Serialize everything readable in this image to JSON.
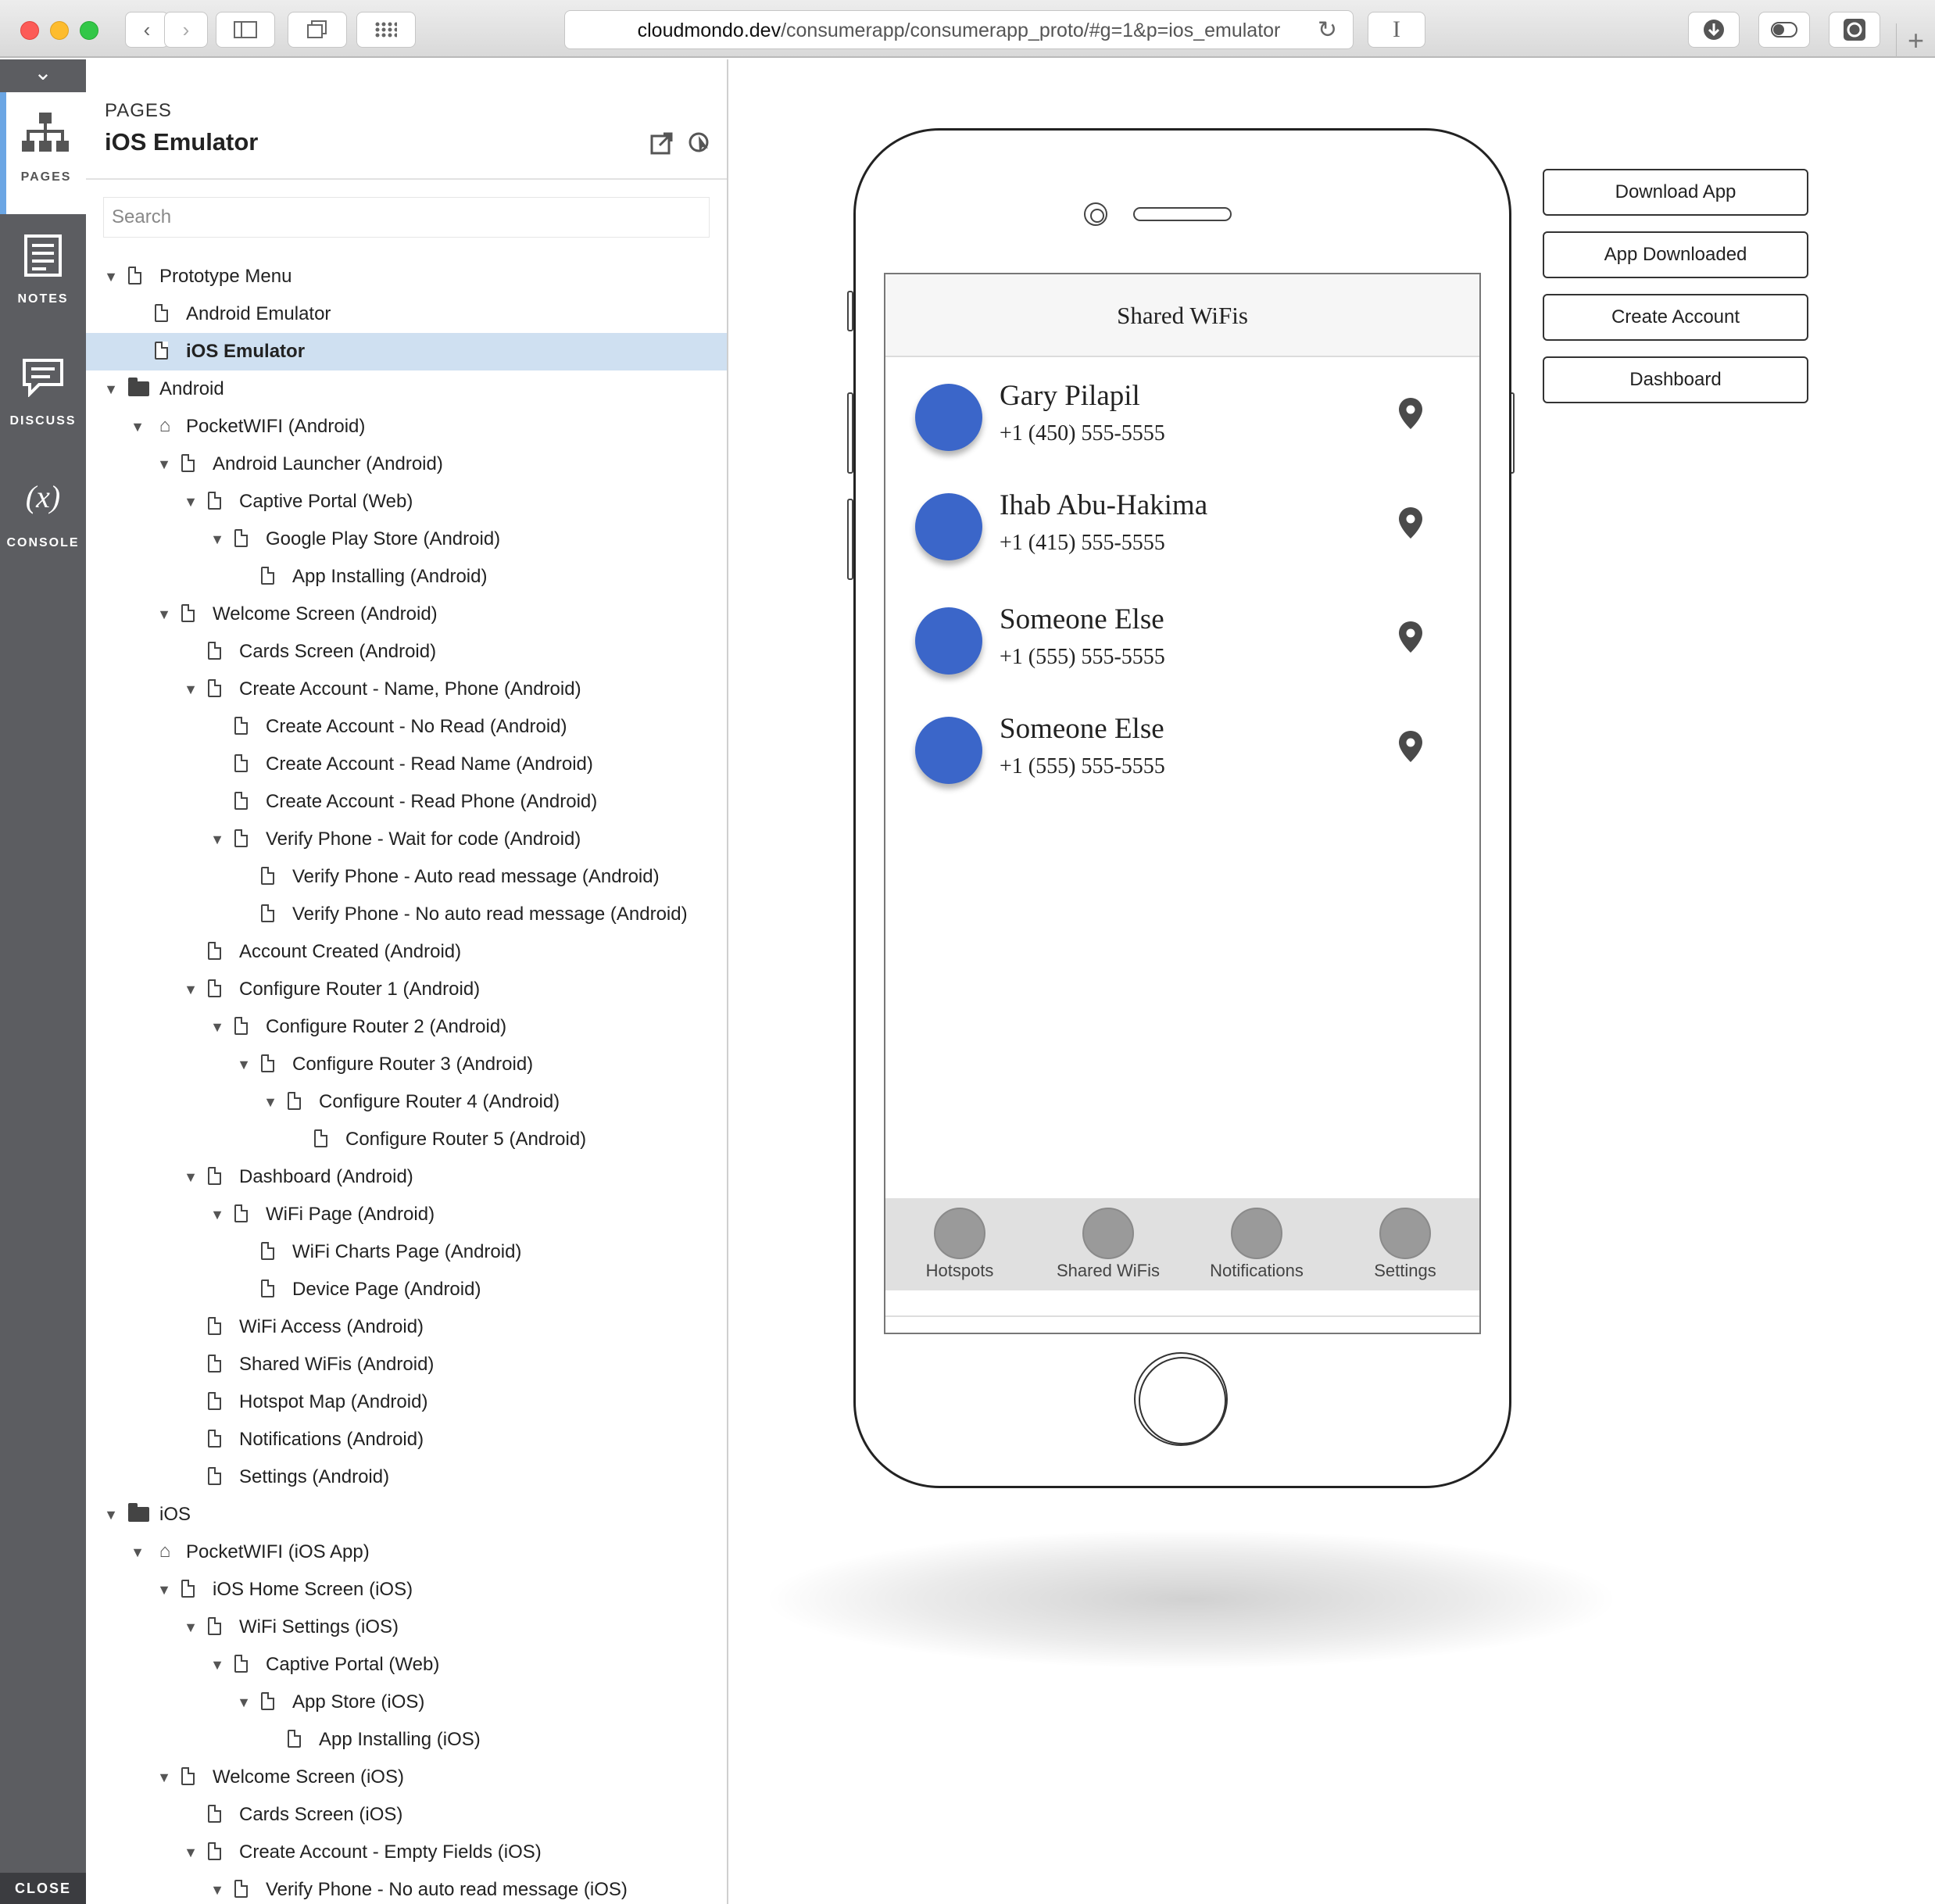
{
  "browser": {
    "url_host": "cloudmondo.dev",
    "url_path": "/consumerapp/consumerapp_proto/#g=1&p=ios_emulator",
    "text_cursor_glyph": "I"
  },
  "rail": {
    "items": [
      {
        "label": "PAGES",
        "icon": "sitemap-icon",
        "active": true
      },
      {
        "label": "NOTES",
        "icon": "notes-icon"
      },
      {
        "label": "DISCUSS",
        "icon": "discuss-icon"
      },
      {
        "label": "CONSOLE",
        "icon": "variable-icon",
        "glyph": "(x)"
      }
    ],
    "close_label": "CLOSE"
  },
  "panel": {
    "subtitle": "PAGES",
    "title": "iOS Emulator",
    "search_placeholder": "Search"
  },
  "tree": [
    {
      "label": "Prototype Menu",
      "level": 0,
      "icon": "page",
      "expanded": true
    },
    {
      "label": "Android Emulator",
      "level": 1,
      "icon": "page"
    },
    {
      "label": "iOS Emulator",
      "level": 1,
      "icon": "page",
      "selected": true
    },
    {
      "label": "Android",
      "level": 0,
      "icon": "folder",
      "expanded": true
    },
    {
      "label": "PocketWIFI (Android)",
      "level": 1,
      "icon": "flow",
      "expanded": true
    },
    {
      "label": "Android Launcher (Android)",
      "level": 2,
      "icon": "page",
      "expanded": true
    },
    {
      "label": "Captive Portal (Web)",
      "level": 3,
      "icon": "page",
      "expanded": true
    },
    {
      "label": "Google Play Store (Android)",
      "level": 4,
      "icon": "page",
      "expanded": true
    },
    {
      "label": "App Installing (Android)",
      "level": 5,
      "icon": "page"
    },
    {
      "label": "Welcome Screen (Android)",
      "level": 2,
      "icon": "page",
      "expanded": true
    },
    {
      "label": "Cards Screen (Android)",
      "level": 3,
      "icon": "page"
    },
    {
      "label": "Create Account - Name, Phone (Android)",
      "level": 3,
      "icon": "page",
      "expanded": true
    },
    {
      "label": "Create Account - No Read (Android)",
      "level": 4,
      "icon": "page"
    },
    {
      "label": "Create Account - Read Name (Android)",
      "level": 4,
      "icon": "page"
    },
    {
      "label": "Create Account - Read Phone (Android)",
      "level": 4,
      "icon": "page"
    },
    {
      "label": "Verify Phone - Wait for code (Android)",
      "level": 4,
      "icon": "page",
      "expanded": true
    },
    {
      "label": "Verify Phone - Auto read message (Android)",
      "level": 5,
      "icon": "page"
    },
    {
      "label": "Verify Phone - No auto read message (Android)",
      "level": 5,
      "icon": "page"
    },
    {
      "label": "Account Created (Android)",
      "level": 3,
      "icon": "page"
    },
    {
      "label": "Configure Router 1 (Android)",
      "level": 3,
      "icon": "page",
      "expanded": true
    },
    {
      "label": "Configure Router 2 (Android)",
      "level": 4,
      "icon": "page",
      "expanded": true
    },
    {
      "label": "Configure Router 3 (Android)",
      "level": 5,
      "icon": "page",
      "expanded": true
    },
    {
      "label": "Configure Router 4 (Android)",
      "level": 6,
      "icon": "page",
      "expanded": true
    },
    {
      "label": "Configure Router 5 (Android)",
      "level": 7,
      "icon": "page"
    },
    {
      "label": "Dashboard (Android)",
      "level": 3,
      "icon": "page",
      "expanded": true
    },
    {
      "label": "WiFi Page (Android)",
      "level": 4,
      "icon": "page",
      "expanded": true
    },
    {
      "label": "WiFi Charts Page (Android)",
      "level": 5,
      "icon": "page"
    },
    {
      "label": "Device Page (Android)",
      "level": 5,
      "icon": "page"
    },
    {
      "label": "WiFi Access (Android)",
      "level": 3,
      "icon": "page"
    },
    {
      "label": "Shared WiFis (Android)",
      "level": 3,
      "icon": "page"
    },
    {
      "label": "Hotspot Map (Android)",
      "level": 3,
      "icon": "page"
    },
    {
      "label": "Notifications (Android)",
      "level": 3,
      "icon": "page"
    },
    {
      "label": "Settings (Android)",
      "level": 3,
      "icon": "page"
    },
    {
      "label": "iOS",
      "level": 0,
      "icon": "folder",
      "expanded": true
    },
    {
      "label": "PocketWIFI (iOS App)",
      "level": 1,
      "icon": "flow",
      "expanded": true
    },
    {
      "label": "iOS Home Screen (iOS)",
      "level": 2,
      "icon": "page",
      "expanded": true
    },
    {
      "label": "WiFi Settings (iOS)",
      "level": 3,
      "icon": "page",
      "expanded": true
    },
    {
      "label": "Captive Portal (Web)",
      "level": 4,
      "icon": "page",
      "expanded": true
    },
    {
      "label": "App Store (iOS)",
      "level": 5,
      "icon": "page",
      "expanded": true
    },
    {
      "label": "App Installing (iOS)",
      "level": 6,
      "icon": "page"
    },
    {
      "label": "Welcome Screen (iOS)",
      "level": 2,
      "icon": "page",
      "expanded": true
    },
    {
      "label": "Cards Screen (iOS)",
      "level": 3,
      "icon": "page"
    },
    {
      "label": "Create Account - Empty Fields (iOS)",
      "level": 3,
      "icon": "page",
      "expanded": true
    },
    {
      "label": "Verify Phone - No auto read message (iOS)",
      "level": 4,
      "icon": "page",
      "expanded": true
    }
  ],
  "phone": {
    "header": "Shared WiFis",
    "contacts": [
      {
        "name": "Gary Pilapil",
        "phone": "+1 (450) 555-5555"
      },
      {
        "name": "Ihab Abu-Hakima",
        "phone": "+1 (415) 555-5555"
      },
      {
        "name": "Someone Else",
        "phone": "+1 (555) 555-5555"
      },
      {
        "name": "Someone Else",
        "phone": "+1 (555) 555-5555"
      }
    ],
    "tabs": [
      "Hotspots",
      "Shared WiFis",
      "Notifications",
      "Settings"
    ],
    "avatar_color": "#3b66c9"
  },
  "actions": [
    "Download App",
    "App Downloaded",
    "Create Account",
    "Dashboard"
  ]
}
